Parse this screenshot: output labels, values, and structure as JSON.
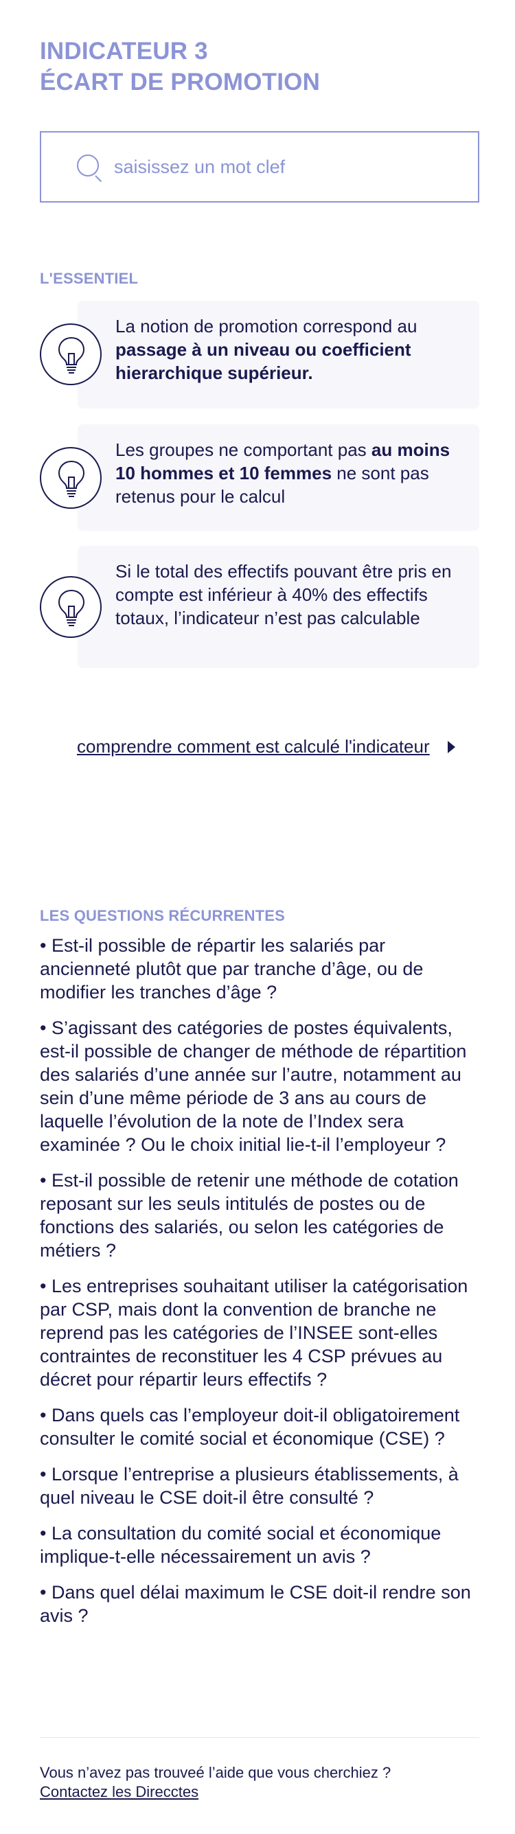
{
  "header": {
    "title_line1": "INDICATEUR 3",
    "title_line2": "ÉCART DE PROMOTION"
  },
  "search": {
    "placeholder": "saisissez un mot clef",
    "icon": "search-icon"
  },
  "essentiel": {
    "label": "L'ESSENTIEL",
    "cards": [
      {
        "icon": "lightbulb-icon",
        "text_plain_1": "La notion de promotion correspond au ",
        "text_bold_1": "passage à un niveau ou coefficient hierarchique supérieur.",
        "text_plain_2": ""
      },
      {
        "icon": "lightbulb-icon",
        "text_plain_1": "Les groupes ne comportant pas ",
        "text_bold_1": "au moins 10 hommes et 10 femmes",
        "text_plain_2": " ne sont pas retenus pour le calcul"
      },
      {
        "icon": "lightbulb-icon",
        "text_plain_1": "Si le total des effectifs pouvant être pris en compte est inférieur à 40% des effectifs totaux, l’indicateur n’est pas calculable",
        "text_bold_1": "",
        "text_plain_2": ""
      }
    ],
    "link_label": "comprendre comment est calculé l'indicateur",
    "link_icon": "triangle-right-icon"
  },
  "faq": {
    "label": "LES QUESTIONS RÉCURRENTES",
    "items": [
      "• Est-il possible de répartir les salariés par ancienneté plutôt que par tranche d’âge, ou de modifier les tranches d’âge ?",
      "• S’agissant des catégories de postes équivalents, est-il possible de changer de méthode de répartition des salariés d’une année sur l’autre, notamment au sein d’une même période de 3 ans au cours de laquelle l’évolution de la note de l’Index sera examinée ? Ou le choix initial lie-t-il l’employeur ?",
      "• Est-il possible de retenir une méthode de cotation reposant sur les seuls intitulés de postes ou de fonctions des salariés, ou selon les catégories de métiers ?",
      "• Les entreprises souhaitant utiliser la catégorisation par CSP, mais dont la convention de branche ne reprend pas les catégories de l’INSEE sont-elles contraintes de reconstituer les 4 CSP prévues au décret pour répartir leurs effectifs ?",
      "• Dans quels cas l’employeur doit-il obligatoirement consulter le comité social et économique (CSE) ?",
      "• Lorsque l’entreprise a plusieurs établissements, à quel niveau le CSE doit-il être consulté ?",
      "• La consultation du comité social et économique implique-t-elle nécessairement un avis ?",
      "• Dans quel délai maximum le CSE doit-il rendre son avis ?"
    ]
  },
  "footer": {
    "question": "Vous n’avez pas trouveé l’aide que vous cherchiez ?",
    "link": "Contactez les Direcctes"
  },
  "colors": {
    "accent": "#8c94d6",
    "text": "#1a1a4e",
    "card_bg": "#f6f6fb"
  }
}
